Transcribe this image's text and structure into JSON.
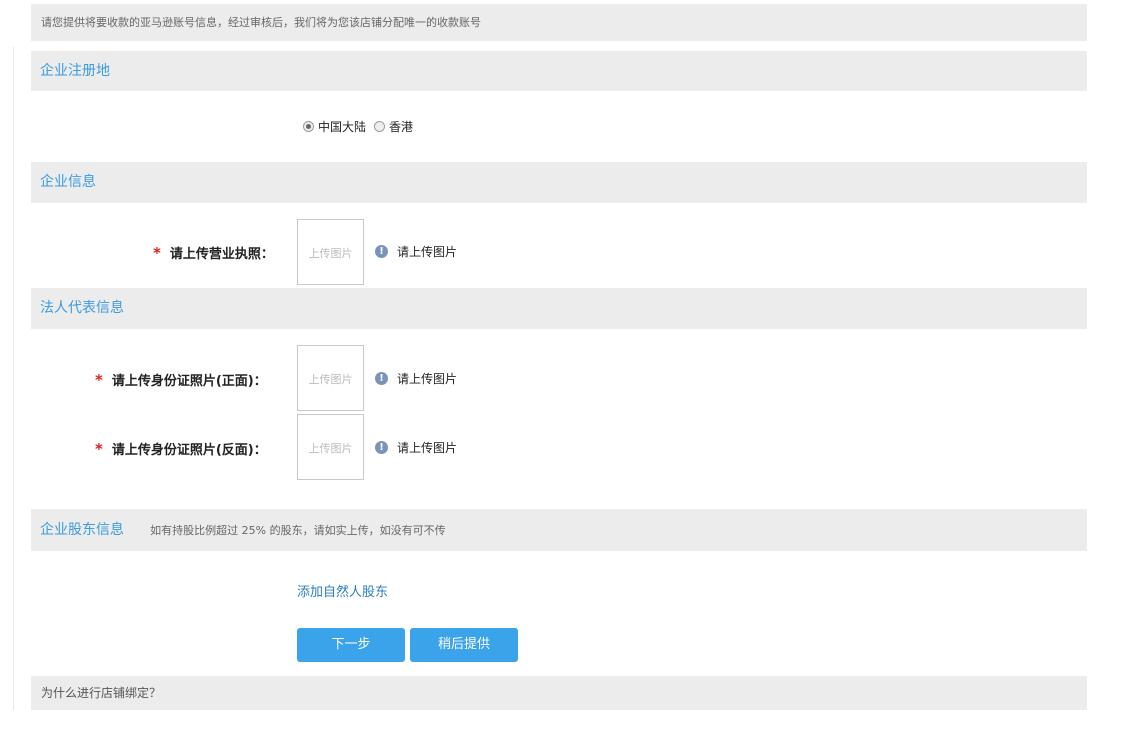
{
  "notice": "请您提供将要收款的亚马逊账号信息，经过审核后，我们将为您该店铺分配唯一的收款账号",
  "section_registration": {
    "title": "企业注册地",
    "options": [
      {
        "label": "中国大陆",
        "checked": true
      },
      {
        "label": "香港",
        "checked": false
      }
    ]
  },
  "section_company": {
    "title": "企业信息",
    "license_label": "请上传营业执照：",
    "upload_placeholder": "上传图片",
    "hint": "请上传图片"
  },
  "section_legal_rep": {
    "title": "法人代表信息",
    "id_front_label": "请上传身份证照片(正面)：",
    "id_back_label": "请上传身份证照片(反面)：",
    "upload_placeholder": "上传图片",
    "hint": "请上传图片"
  },
  "section_shareholders": {
    "title": "企业股东信息",
    "hint": "如有持股比例超过 25% 的股东，请如实上传，如没有可不传",
    "add_link": "添加自然人股东"
  },
  "buttons": {
    "next": "下一步",
    "later": "稍后提供"
  },
  "faq": "为什么进行店铺绑定？",
  "colors": {
    "accent": "#3aa3ea",
    "section_title": "#3a9be0",
    "required": "#e02020",
    "panel_bg": "#ececec"
  },
  "icons": {
    "info": "info-circle-icon"
  }
}
